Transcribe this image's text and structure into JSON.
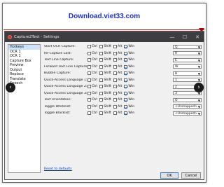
{
  "banner": {
    "text": "Download.viet33.com"
  },
  "window": {
    "title": "Capture2Text - Settings",
    "controls": {
      "minimize": "—",
      "maximize": "☐",
      "close": "✕"
    }
  },
  "sidebar": {
    "items": [
      "Hotkeys",
      "OCR 1",
      "OCR 1",
      "Capture Box",
      "Preview",
      "Output",
      "Replace",
      "Translate",
      "Speech"
    ],
    "selected_index": 0
  },
  "modifiers": {
    "ctrl": "Ctrl",
    "shift": "Shift",
    "alt": "Alt",
    "win": "Win"
  },
  "hotkeys": [
    {
      "label": "Start OCR Capture:",
      "key": "Q"
    },
    {
      "label": "Re-Capture Last:",
      "key": "R"
    },
    {
      "label": "Text Line Capture:",
      "key": "E"
    },
    {
      "label": "Forward Text Line Capture:",
      "key": "W"
    },
    {
      "label": "Bubble Capture:",
      "key": "B"
    },
    {
      "label": "Quick-Access Language 1:",
      "key": "1"
    },
    {
      "label": "Quick-Access Language 2:",
      "key": "2"
    },
    {
      "label": "Quick-Access Language 3:",
      "key": "3"
    },
    {
      "label": "Text Orientation:",
      "key": "O"
    },
    {
      "label": "Toggle Whitelist:",
      "key": "<Unmapped>"
    },
    {
      "label": "Toggle Blacklist:",
      "key": "<Unmapped>"
    }
  ],
  "footer": {
    "reset_link": "Reset to defaults",
    "ok": "OK",
    "cancel": "Cancel"
  },
  "nav": {
    "prev": "‹",
    "next": "›"
  },
  "colors": {
    "banner_text": "#1f2fd6",
    "titlebar": "#3e3e42",
    "selection": "#cce3fb",
    "link": "#0645ad"
  }
}
